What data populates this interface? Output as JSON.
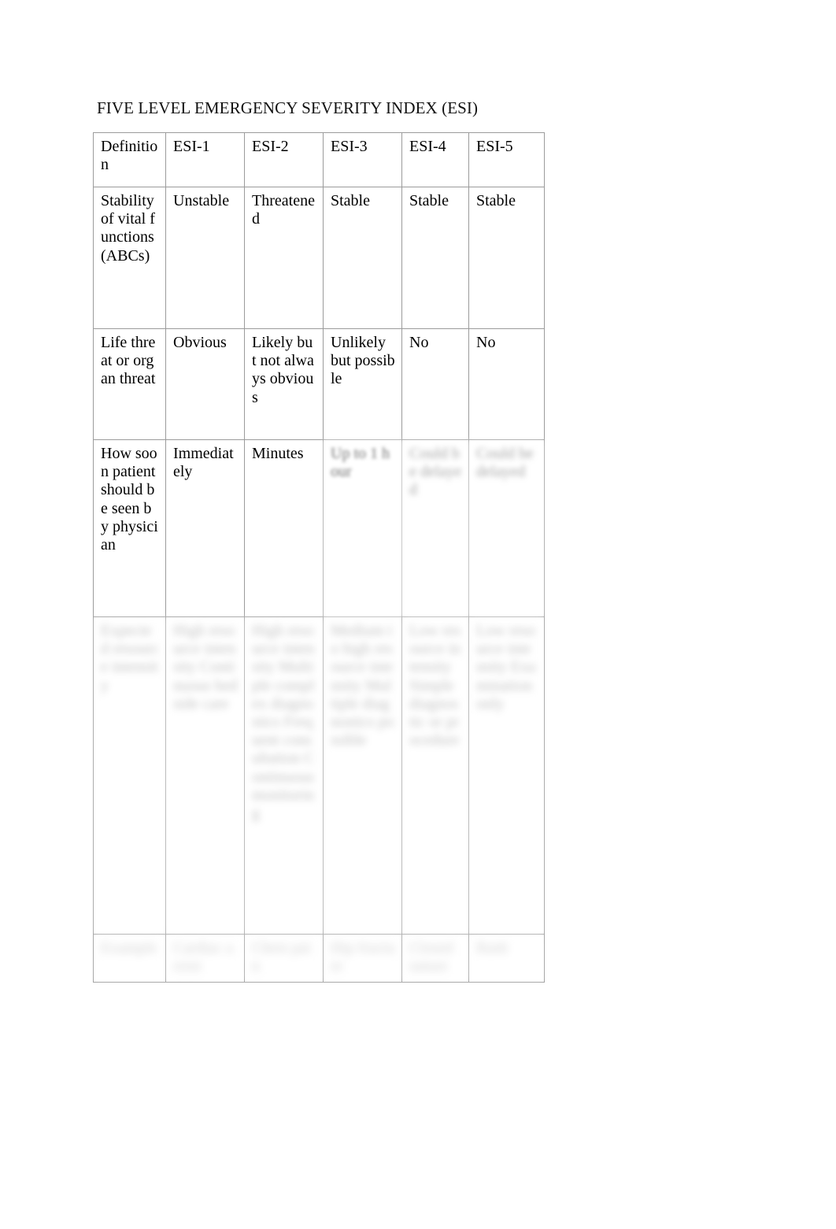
{
  "document": {
    "title": "FIVE LEVEL EMERGENCY SEVERITY INDEX (ESI)"
  },
  "table": {
    "columns": [
      "Definition",
      "ESI-1",
      "ESI-2",
      "ESI-3",
      "ESI-4",
      "ESI-5"
    ],
    "header": {
      "definition": "Definition",
      "esi1": "ESI-1",
      "esi2": "ESI-2",
      "esi3": "ESI-3",
      "esi4": "ESI-4",
      "esi5": "ESI-5"
    },
    "rows": [
      {
        "label": "Stability of vital functions (ABCs)",
        "esi1": "Unstable",
        "esi2": "Threatened",
        "esi3": "Stable",
        "esi4": "Stable",
        "esi5": "Stable",
        "legibility": [
          "clear",
          "clear",
          "clear",
          "clear",
          "clear",
          "clear"
        ]
      },
      {
        "label": "Life threat or organ threat",
        "esi1": "Obvious",
        "esi2": "Likely but not always obvious",
        "esi3": "Unlikely but possible",
        "esi4": "No",
        "esi5": "No",
        "legibility": [
          "clear",
          "clear",
          "clear",
          "clear",
          "clear",
          "clear"
        ]
      },
      {
        "label": "How soon patient should be seen by physician",
        "esi1": "Immediately",
        "esi2": "Minutes",
        "esi3": "Up to 1 hour",
        "esi4": "Could be delayed",
        "esi5": "Could be delayed",
        "legibility": [
          "clear",
          "clear",
          "clear",
          "partial",
          "blurred",
          "blurred"
        ]
      },
      {
        "label": "Expected resource intensity",
        "esi1": "High resource intensity Continuous bedside care",
        "esi2": "High resource intensity Multiple complex diagnostics Frequent consultation Continuous monitoring",
        "esi3": "Medium to high resource intensity Multiple diagnostics possible",
        "esi4": "Low resource intensity Simple diagnostic or procedure",
        "esi5": "Low resource intensity Examination only",
        "legibility": [
          "blurred",
          "blurred",
          "blurred",
          "blurred",
          "blurred",
          "blurred"
        ]
      },
      {
        "label": "Example",
        "esi1": "Cardiac arrest",
        "esi2": "Chest pain",
        "esi3": "Hip fracture",
        "esi4": "Closed suture",
        "esi5": "Rash",
        "legibility": [
          "blurred",
          "blurred",
          "blurred",
          "blurred",
          "blurred",
          "blurred"
        ]
      }
    ]
  }
}
